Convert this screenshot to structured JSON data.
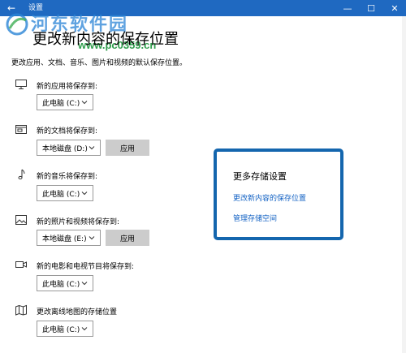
{
  "window": {
    "title": "设置",
    "back": "←",
    "min": "—",
    "max": "☐",
    "close": "✕"
  },
  "watermark": {
    "site": "河东软件园",
    "url": "www.pc0359.cn"
  },
  "page": {
    "title": "更改新内容的保存位置",
    "description": "更改应用、文档、音乐、图片和视频的默认保存位置。"
  },
  "sections": [
    {
      "label": "新的应用将保存到:",
      "drive": "此电脑 (C:)",
      "apply": "",
      "icon": "monitor-icon"
    },
    {
      "label": "新的文档将保存到:",
      "drive": "本地磁盘 (D:)",
      "apply": "应用",
      "icon": "document-folder-icon"
    },
    {
      "label": "新的音乐将保存到:",
      "drive": "此电脑 (C:)",
      "apply": "",
      "icon": "music-note-icon"
    },
    {
      "label": "新的照片和视频将保存到:",
      "drive": "本地磁盘 (E:)",
      "apply": "应用",
      "icon": "picture-icon"
    },
    {
      "label": "新的电影和电视节目将保存到:",
      "drive": "此电脑 (C:)",
      "apply": "",
      "icon": "video-camera-icon"
    },
    {
      "label": "更改离线地图的存储位置",
      "drive": "此电脑 (C:)",
      "apply": "",
      "icon": "map-icon"
    }
  ],
  "related": {
    "title": "更多存储设置",
    "links": [
      "更改新内容的保存位置",
      "管理存储空间"
    ]
  },
  "colors": {
    "titlebar": "#1f69c1",
    "link": "#1463c4",
    "highlight_border": "#1466ae"
  }
}
